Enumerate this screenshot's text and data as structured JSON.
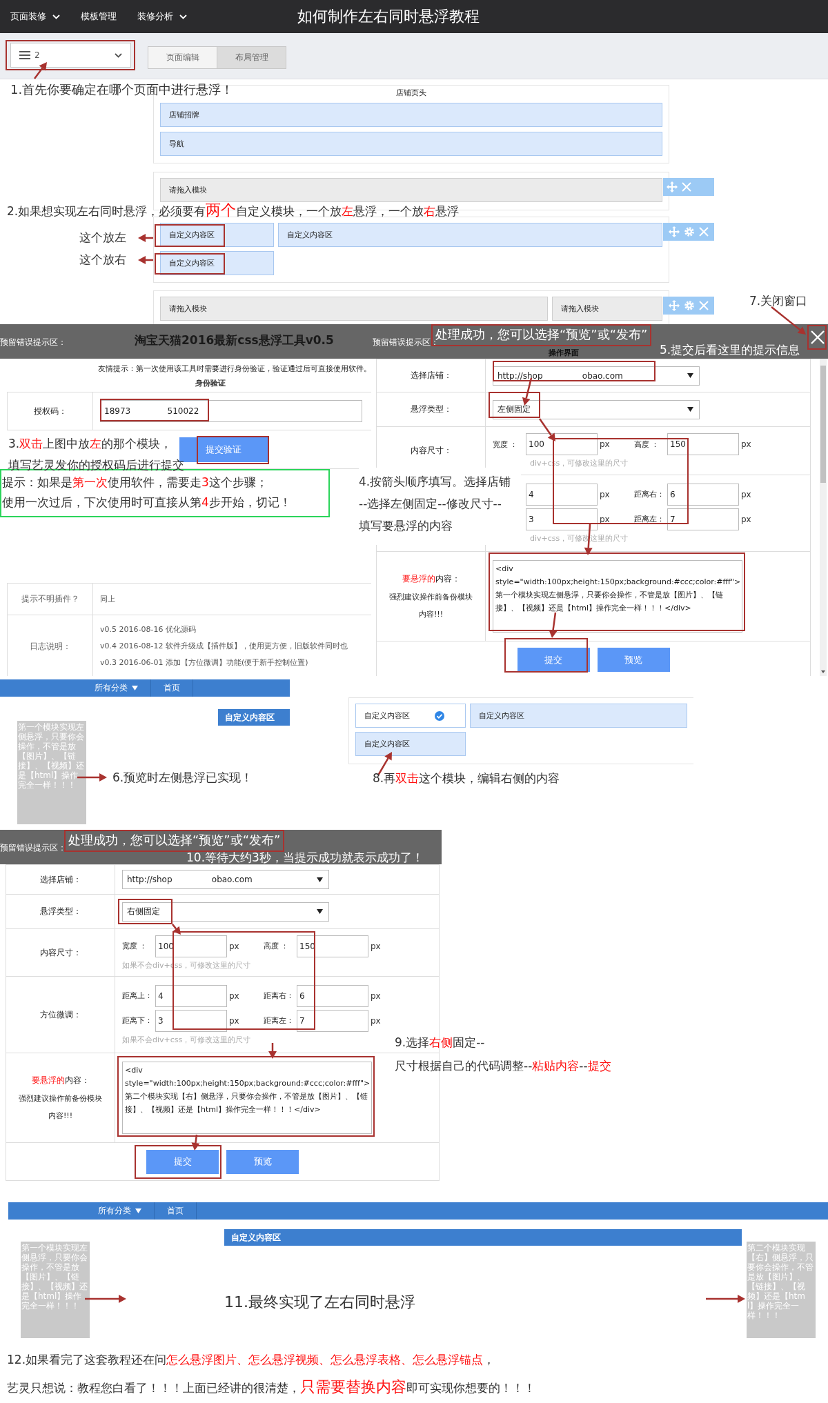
{
  "top_bar": {
    "menus": [
      {
        "label": "页面装修",
        "dropdown": true
      },
      {
        "label": "模板管理",
        "dropdown": false
      },
      {
        "label": "装修分析",
        "dropdown": true
      }
    ],
    "title": "如何制作左右同时悬浮教程"
  },
  "toolbar": {
    "page_select": {
      "value": "2"
    },
    "tabs": [
      {
        "label": "页面编辑",
        "selected": false
      },
      {
        "label": "布局管理",
        "selected": true
      }
    ]
  },
  "step1": [
    {
      "text": "1.首先你要确定在哪个页面中进行悬浮！",
      "red": false
    }
  ],
  "layout_editor": {
    "header": {
      "title": "店铺页头",
      "rows": [
        "店铺招牌",
        "导航"
      ]
    },
    "sections": [
      {
        "kind": "single",
        "rows": [
          [
            {
              "label": "请拖入模块",
              "kind": "placeholder"
            }
          ]
        ],
        "tools": [
          {
            "kind": "move"
          },
          {
            "kind": "close"
          }
        ]
      },
      {
        "kind": "side-main",
        "rows": [
          [
            {
              "label": "自定义内容区",
              "kind": "custom"
            },
            {
              "label": "自定义内容区",
              "kind": "custom"
            }
          ],
          [
            {
              "label": "自定义内容区",
              "kind": "custom"
            }
          ]
        ],
        "tools": [
          {
            "kind": "move"
          },
          {
            "kind": "settings"
          },
          {
            "kind": "close"
          }
        ]
      },
      {
        "kind": "main-side",
        "rows": [
          [
            {
              "label": "请拖入模块",
              "kind": "placeholder"
            },
            {
              "label": "请拖入模块",
              "kind": "placeholder"
            }
          ]
        ],
        "tools": [
          {
            "kind": "move"
          },
          {
            "kind": "settings"
          },
          {
            "kind": "close"
          }
        ]
      }
    ]
  },
  "step2": [
    {
      "text": "2.如果想实现左右同时悬浮，必须要有",
      "red": false
    },
    {
      "text": "两个",
      "red": true,
      "large": true
    },
    {
      "text": "自定义模块，一个放",
      "red": false
    },
    {
      "text": "左",
      "red": true
    },
    {
      "text": "悬浮，一个放",
      "red": false
    },
    {
      "text": "右",
      "red": true
    },
    {
      "text": "悬浮",
      "red": false
    }
  ],
  "side_labels": [
    "这个放左",
    "这个放右"
  ],
  "step7": "7.关闭窗口",
  "auth_dialog": {
    "error_area": "预留错误提示区：",
    "title": "淘宝天猫2016最新css悬浮工具v0.5",
    "notice": "友情提示：第一次使用该工具时需要进行身份验证，验证通过后可直接使用软件。",
    "section": "身份验证",
    "code_label": "授权码：",
    "code_value": "18973              510022",
    "verify_button": "提交验证",
    "rows": [
      {
        "label": "提示不明插件？",
        "lines": [
          "同上"
        ]
      },
      {
        "label": "日志说明：",
        "lines": [
          "v0.5 2016-08-16 优化源码",
          "v0.4 2016-08-12 软件升级成【插件版】，使用更方便，旧版软件同时也",
          "v0.3 2016-06-01 添加【方位微调】功能(便于新手控制位置)"
        ]
      }
    ]
  },
  "step3": [
    [
      {
        "text": "3.",
        "red": false
      },
      {
        "text": "双击",
        "red": true
      },
      {
        "text": "上图中放",
        "red": false
      },
      {
        "text": "左",
        "red": true
      },
      {
        "text": "的那个模块，",
        "red": false
      }
    ],
    [
      {
        "text": "填写艺灵发你的授权码后进行提交",
        "red": false
      }
    ]
  ],
  "tip": [
    [
      {
        "text": "提示：如果是",
        "red": false
      },
      {
        "text": "第一次",
        "red": true
      },
      {
        "text": "使用软件，需要走",
        "red": false
      },
      {
        "text": "3",
        "red": true
      },
      {
        "text": "这个步骤；",
        "red": false
      }
    ],
    [
      {
        "text": "使用一次过后，下次使用时可直接从第",
        "red": false
      },
      {
        "text": "4",
        "red": true
      },
      {
        "text": "步开始，切记！",
        "red": false
      }
    ]
  ],
  "form_dialog_1": {
    "error_area": "预留错误提示区：",
    "toast": "处理成功，您可以选择“预览”或“发布”",
    "heading": "操作界面",
    "close": true,
    "store": {
      "label": "选择店铺：",
      "value": "http://shop               obao.com"
    },
    "float_type": {
      "label": "悬浮类型：",
      "value": "左侧固定"
    },
    "size": {
      "label": "内容尺寸：",
      "fields": [
        {
          "label": "宽度 ：",
          "value": "100",
          "unit": "px"
        },
        {
          "label": "高度 ：",
          "value": "150",
          "unit": "px"
        }
      ],
      "hint": "div+css，可修改这里的尺寸"
    },
    "position": {
      "rows": [
        [
          {
            "value": "4",
            "unit": "px"
          },
          {
            "label": "距离右：",
            "value": "6",
            "unit": "px"
          }
        ],
        [
          {
            "value": "3",
            "unit": "px"
          },
          {
            "label": "距离左：",
            "value": "7",
            "unit": "px"
          }
        ]
      ],
      "hint": "div+css，可修改这里的尺寸"
    },
    "content": {
      "label": [
        {
          "text": "要悬浮的",
          "red": true
        },
        {
          "text": "内容：",
          "red": false
        }
      ],
      "advice": [
        "强烈建议操作前备份模块",
        "内容!!!"
      ],
      "value": "<div style=\"width:100px;height:150px;background:#ccc;color:#fff\">第一个模块实现左侧悬浮，只要你会操作，不管是放【图片】、【链接】、【视频】还是【html】操作完全一样！！！</div>"
    },
    "buttons": [
      "提交",
      "预览"
    ]
  },
  "step4": [
    "4.按箭头顺序填写。选择店铺",
    "--选择左侧固定--修改尺寸--",
    "填写要悬浮的内容"
  ],
  "step5": "5.提交后看这里的提示信息",
  "preview_left": {
    "nav": [
      {
        "label": "所有分类",
        "dropdown": true
      },
      {
        "label": "首页",
        "dropdown": false
      }
    ],
    "tag": "自定义内容区",
    "float_text": "第一个模块实现左侧悬浮，只要你会操作，不管是放【图片】、【链接】、【视频】还是【html】操作完全一样！！！"
  },
  "step6": "6.预览时左侧悬浮已实现！",
  "layout_detail": {
    "rows": [
      [
        {
          "label": "自定义内容区",
          "checked": true
        },
        {
          "label": "自定义内容区",
          "checked": false
        }
      ],
      [
        {
          "label": "自定义内容区",
          "checked": false
        }
      ]
    ]
  },
  "step8": [
    {
      "text": "8.再",
      "red": false
    },
    {
      "text": "双击",
      "red": true
    },
    {
      "text": "这个模块，编辑右侧的内容",
      "red": false
    }
  ],
  "form_dialog_2": {
    "error_area": "预留错误提示区：",
    "toast": "处理成功，您可以选择“预览”或“发布”",
    "close": false,
    "store": {
      "label": "选择店铺：",
      "value": "http://shop               obao.com"
    },
    "float_type": {
      "label": "悬浮类型：",
      "value": "右侧固定"
    },
    "size": {
      "label": "内容尺寸：",
      "fields": [
        {
          "label": "宽度 ：",
          "value": "100",
          "unit": "px"
        },
        {
          "label": "高度 ：",
          "value": "150",
          "unit": "px"
        }
      ],
      "hint": "如果不会div+css，可修改这里的尺寸"
    },
    "position": {
      "label": "方位微调：",
      "rows": [
        [
          {
            "label": "距离上：",
            "value": "4",
            "unit": "px"
          },
          {
            "label": "距离右：",
            "value": "6",
            "unit": "px"
          }
        ],
        [
          {
            "label": "距离下：",
            "value": "3",
            "unit": "px"
          },
          {
            "label": "距离左：",
            "value": "7",
            "unit": "px"
          }
        ]
      ],
      "hint": "如果不会div+css，可修改这里的尺寸"
    },
    "content": {
      "label": [
        {
          "text": "要悬浮的",
          "red": true
        },
        {
          "text": "内容：",
          "red": false
        }
      ],
      "advice": [
        "强烈建议操作前备份模块",
        "内容!!!"
      ],
      "value": "<div style=\"width:100px;height:150px;background:#ccc;color:#fff\">第二个模块实现【右】侧悬浮，只要你会操作，不管是放【图片】、【链接】、【视频】还是【html】操作完全一样！！！</div>"
    },
    "buttons": [
      "提交",
      "预览"
    ]
  },
  "step10": "10.等待大约3秒，当提示成功就表示成功了！",
  "step9": [
    [
      {
        "text": "9.选择",
        "red": false
      },
      {
        "text": "右侧",
        "red": true
      },
      {
        "text": "固定--",
        "red": false
      }
    ],
    [
      {
        "text": "尺寸根据自己的代码调整--",
        "red": false
      },
      {
        "text": "粘贴内容",
        "red": true
      },
      {
        "text": "--",
        "red": false
      },
      {
        "text": "提交",
        "red": true
      }
    ]
  ],
  "final_preview": {
    "nav": [
      {
        "label": "所有分类",
        "dropdown": true
      },
      {
        "label": "首页",
        "dropdown": false
      }
    ],
    "tag": "自定义内容区",
    "left_float": "第一个模块实现左侧悬浮，只要你会操作，不管是放【图片】、【链接】、【视频】还是【html】操作完全一样！！！",
    "right_float": "第二个模块实现【右】侧悬浮，只要你会操作，不管是放【图片】、【链接】、【视频】还是【html】操作完全一样！！！"
  },
  "step11": "11.最终实现了左右同时悬浮",
  "step12": [
    {
      "text": "12.如果看完了这套教程还在问",
      "red": false
    },
    {
      "text": "怎么悬浮图片、怎么悬浮视频、怎么悬浮表格、怎么悬浮锚点",
      "red": true
    },
    {
      "text": "，",
      "red": false
    }
  ],
  "closing": [
    {
      "text": "艺灵只想说：教程您白看了！！！上面已经讲的很清楚，",
      "red": false
    },
    {
      "text": "只需要替换内容",
      "red": true,
      "large": true
    },
    {
      "text": "即可实现你想要的！！！",
      "red": false
    }
  ]
}
